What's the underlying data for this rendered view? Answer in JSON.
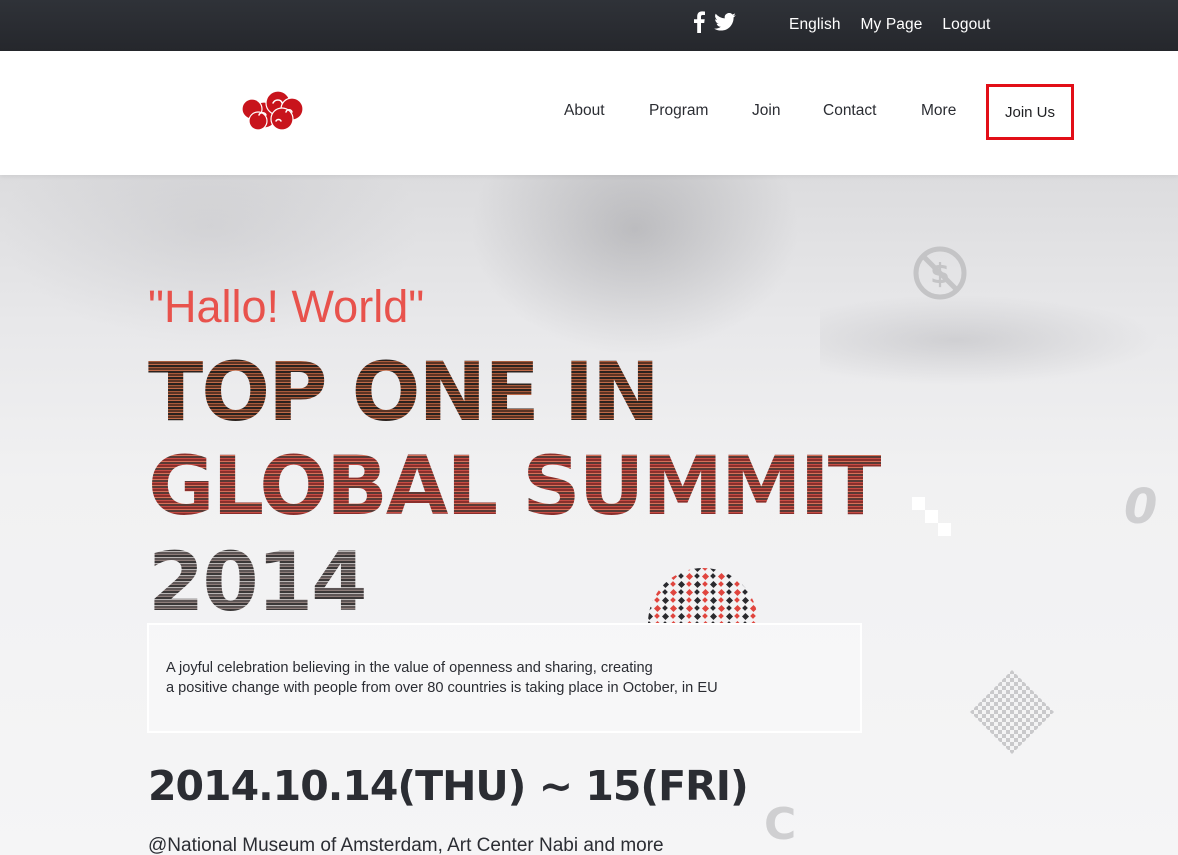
{
  "topbar": {
    "social_icons": [
      "facebook-icon",
      "twitter-icon"
    ],
    "links": {
      "english": "English",
      "my_page": "My Page",
      "logout": "Logout"
    }
  },
  "header": {
    "logo_icon": "red-cloud-logo",
    "nav": [
      "About",
      "Program",
      "Join",
      "Contact",
      "More"
    ],
    "join_us": "Join Us",
    "accent_color": "#e20e17"
  },
  "hero": {
    "tagline": "\"Hallo! World\"",
    "headline": [
      "TOP ONE IN",
      "GLOBAL SUMMIT",
      "2014"
    ],
    "description": [
      "A joyful celebration believing in the value of openness and sharing, creating",
      "a positive change with people from over 80 countries is taking place in October, in EU"
    ],
    "date": "2014.10.14(THU) ~ 15(FRI)",
    "venue": "@National Museum of Amsterdam, Art Center Nabi and more",
    "tagline_color": "#e8524c",
    "decor_glyphs": [
      "0",
      "C"
    ],
    "decor_icons": [
      "no-dollar-icon",
      "pixel-dome-decoration",
      "pixel-diamond-decoration",
      "pixel-steps-decoration"
    ]
  }
}
